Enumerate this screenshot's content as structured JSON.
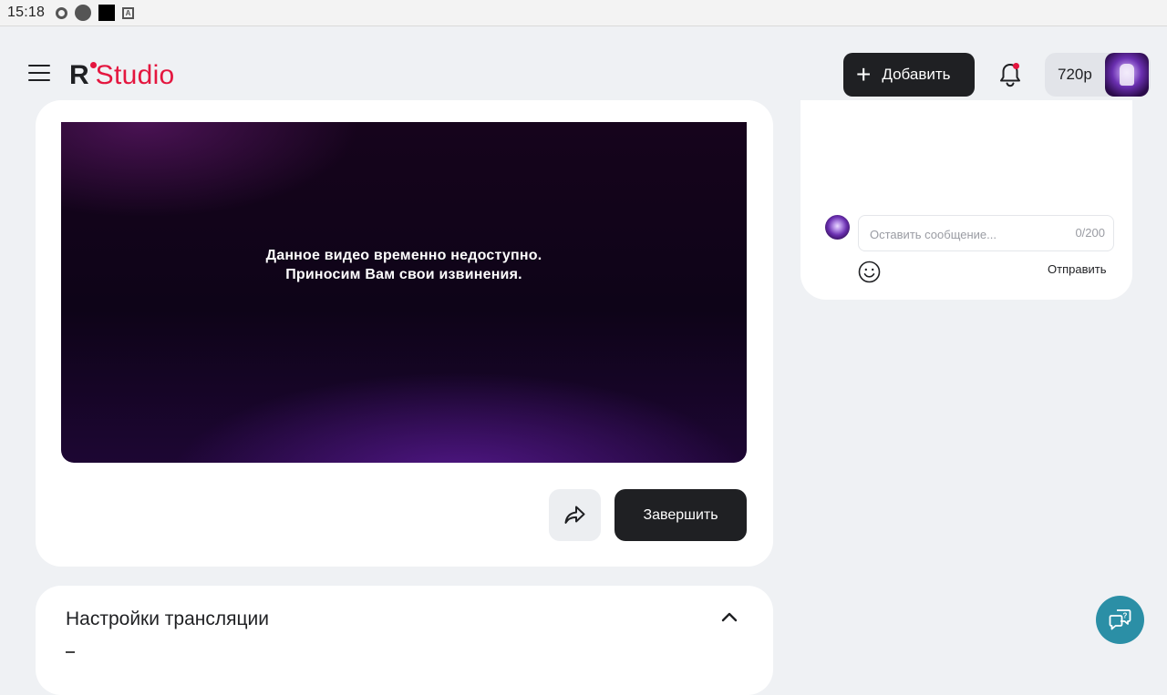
{
  "statusbar": {
    "time": "15:18",
    "icons": [
      "sync-icon",
      "circle-icon",
      "square-icon",
      "keyboard-a-icon"
    ]
  },
  "header": {
    "logo": {
      "mark": "R",
      "word": "Studio"
    },
    "add_button": {
      "icon": "plus-icon",
      "label": "Добавить"
    },
    "notifications_icon": "bell-icon",
    "balance": "720р"
  },
  "video": {
    "message_line1": "Данное видео временно недоступно.",
    "message_line2": "Приносим Вам свои извинения."
  },
  "actions": {
    "share_icon": "share-icon",
    "finish_label": "Завершить"
  },
  "settings": {
    "title": "Настройки трансляции"
  },
  "chat": {
    "input_placeholder": "Оставить сообщение...",
    "input_value": "",
    "counter": "0/200",
    "emoji_icon": "smiley-icon",
    "send_label": "Отправить"
  },
  "help": {
    "icon": "chat-help-icon"
  },
  "colors": {
    "accent": "#e4163f",
    "dark_button": "#1f2023",
    "background": "#eff1f4",
    "help_fab": "#2b8fa6"
  }
}
